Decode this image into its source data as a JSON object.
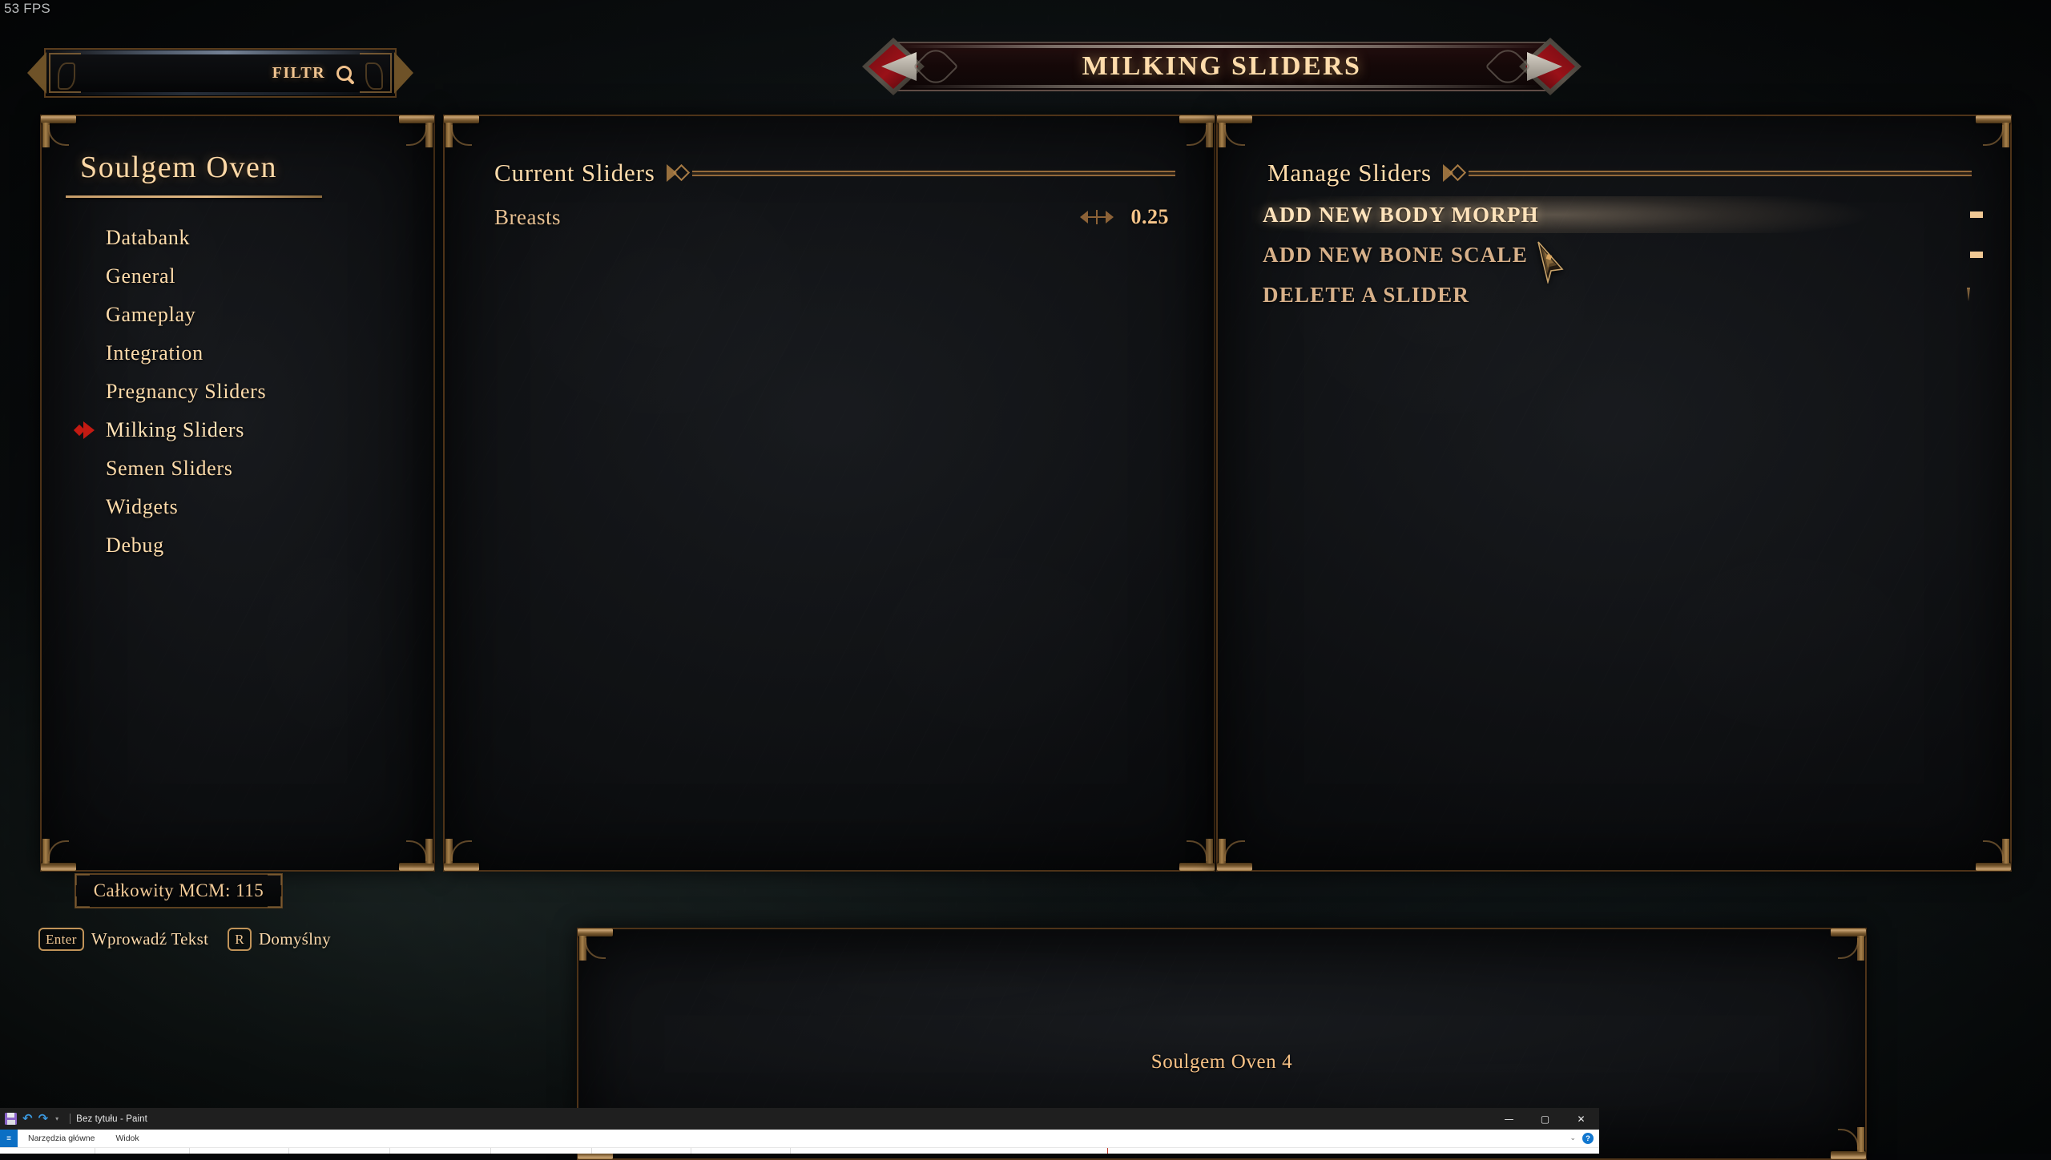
{
  "hud": {
    "fps": "53 FPS"
  },
  "filter": {
    "label": "FILTR",
    "icon": "search-icon"
  },
  "header": {
    "title": "MILKING SLIDERS"
  },
  "sidebar": {
    "title": "Soulgem Oven",
    "items": [
      {
        "label": "Databank",
        "selected": false
      },
      {
        "label": "General",
        "selected": false
      },
      {
        "label": "Gameplay",
        "selected": false
      },
      {
        "label": "Integration",
        "selected": false
      },
      {
        "label": "Pregnancy Sliders",
        "selected": false
      },
      {
        "label": "Milking Sliders",
        "selected": true
      },
      {
        "label": "Semen Sliders",
        "selected": false
      },
      {
        "label": "Widgets",
        "selected": false
      },
      {
        "label": "Debug",
        "selected": false
      }
    ],
    "mcm_total": "Całkowity MCM: 115",
    "key_hints": [
      {
        "key": "Enter",
        "action": "Wprowadź Tekst"
      },
      {
        "key": "R",
        "action": "Domyślny"
      }
    ]
  },
  "current_sliders": {
    "heading": "Current Sliders",
    "rows": [
      {
        "name": "Breasts",
        "value": "0.25",
        "control": "nudge-arrows-icon"
      }
    ]
  },
  "manage_sliders": {
    "heading": "Manage Sliders",
    "options": [
      {
        "label": "ADD NEW BODY MORPH",
        "control": "text-cursor-icon",
        "hovered": true
      },
      {
        "label": "ADD NEW BONE SCALE",
        "control": "text-cursor-icon",
        "hovered": false
      },
      {
        "label": "DELETE A SLIDER",
        "control": "dropdown-icon",
        "hovered": false
      }
    ]
  },
  "info_panel": {
    "text": "Soulgem Oven 4"
  },
  "paint_window": {
    "title": "Bez tytułu - Paint",
    "quick_access": [
      "save-icon",
      "undo-icon",
      "redo-icon",
      "customize-chevron-icon"
    ],
    "window_buttons": {
      "minimize": "—",
      "maximize": "▢",
      "close": "✕"
    },
    "file_tab": "≡",
    "tabs": [
      "Narzędzia główne",
      "Widok"
    ],
    "help": "?",
    "collapse": "⌄"
  },
  "colors": {
    "accent_gold": "#ffdcab",
    "accent_tan": "#d7b089",
    "frame_bronze": "#5a3d1d",
    "selected_marker_red": "#c31a12",
    "title_text": "#ffdcab",
    "value_gold": "#f6c58a"
  }
}
